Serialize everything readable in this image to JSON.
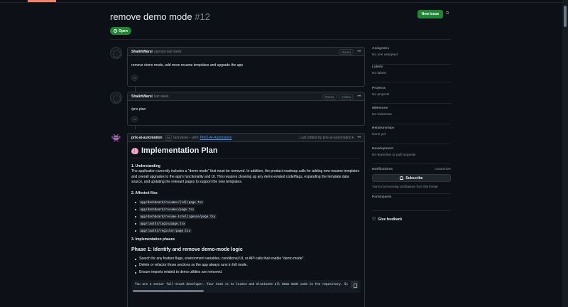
{
  "issue": {
    "title": "remove demo mode",
    "number": "#12",
    "state": "Open",
    "new_issue_label": "New issue"
  },
  "comments": [
    {
      "author": "ShaikhWarsi",
      "meta": "opened last week",
      "roles": [
        "Owner"
      ],
      "body": "remove demo mode, add more resume templates and upgrade the app"
    },
    {
      "author": "ShaikhWarsi",
      "meta": "last week",
      "roles": [
        "Owner",
        "Author"
      ],
      "body": "/prix plan"
    }
  ],
  "bot_comment": {
    "author": "prix-ai-automation",
    "bot_tag": "bot",
    "meta": "last week – with",
    "app_link": "PRIX-AI-Automation",
    "edited": "Last edited by prix-ai-automation",
    "plan": {
      "title": "Implementation Plan",
      "s1_heading": "1. Understanding",
      "s1_text": "The application currently includes a \"demo mode\" that must be removed. In addition, the product roadmap calls for adding new resume templates and overall upgrades to the app's functionality and UI. This requires cleaning up any demo-related code/flags, expanding the template data source, and updating the relevant pages to support the new templates.",
      "s2_heading": "2. Affected files",
      "files": [
        "app/dashboard/resumes/[id]/page.tsx",
        "app/dashboard/resumes/page.tsx",
        "app/dashboard/resume-intelligence/page.tsx",
        "app/(auth)/login/page.tsx",
        "app/(auth)/register/page.tsx"
      ],
      "s3_heading": "3. Implementation phases",
      "phase1_title": "Phase 1: Identify and remove demo-mode logic",
      "phase1_items": [
        "Search for any feature flags, environment variables, conditional UI, or API calls that enable \"demo mode\".",
        "Delete or refactor those sections so the app always runs in full mode.",
        "Ensure imports related to demo utilities are removed."
      ],
      "code": "You are a senior full-stack developer. Your task is to locate and eliminate all demo-mode code in the repository. Sc"
    }
  },
  "sidebar": {
    "assignees": {
      "label": "Assignees",
      "value": "No one assigned"
    },
    "labels": {
      "label": "Labels",
      "value": "No labels"
    },
    "projects": {
      "label": "Projects",
      "value": "No projects"
    },
    "milestone": {
      "label": "Milestone",
      "value": "No milestone"
    },
    "relationships": {
      "label": "Relationships",
      "value": "None yet"
    },
    "development": {
      "label": "Development",
      "value": "No branches or pull requests"
    },
    "notifications": {
      "label": "Notifications",
      "customize": "Customize",
      "subscribe": "Subscribe",
      "note": "You're not receiving notifications from this thread."
    },
    "participants": {
      "label": "Participants"
    },
    "feedback": "Give feedback"
  },
  "colors": {
    "background": "#0d1117",
    "open_green": "#238636",
    "link_blue": "#4493f8"
  }
}
